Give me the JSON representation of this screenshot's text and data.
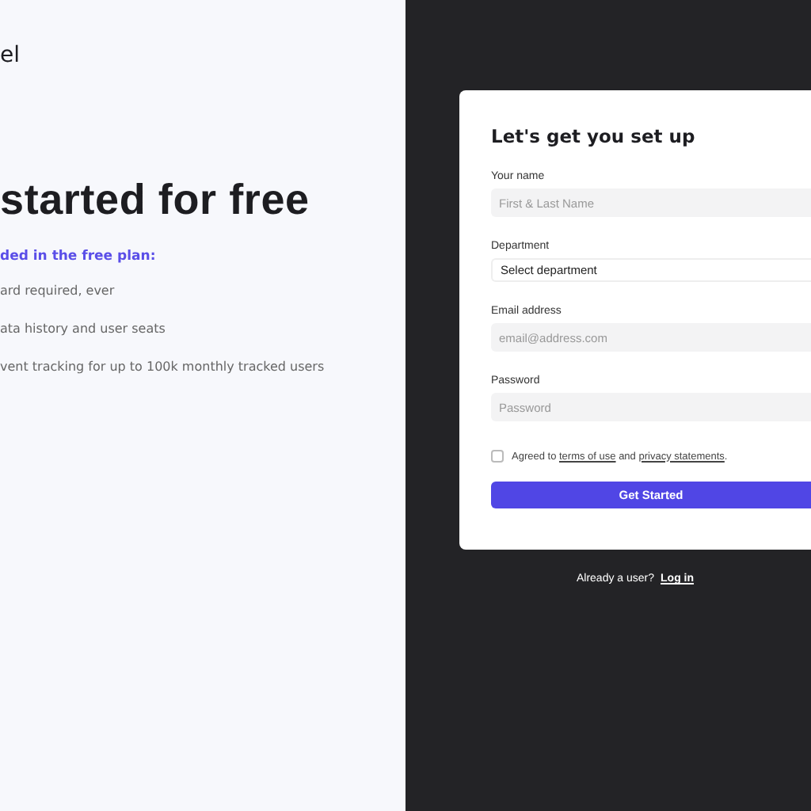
{
  "brand": {
    "text": "el"
  },
  "hero": {
    "title": "started for free",
    "subtitle": "ded in the free plan:",
    "bullets": [
      "ard required, ever",
      "ata history and user seats",
      "vent tracking for up to 100k monthly tracked users"
    ]
  },
  "form": {
    "title": "Let's get you set up",
    "fields": [
      {
        "kind": "text",
        "label": "Your name",
        "placeholder": "First & Last Name"
      },
      {
        "kind": "select",
        "label": "Department",
        "value": "Select department"
      },
      {
        "kind": "text",
        "label": "Email address",
        "placeholder": "email@address.com"
      },
      {
        "kind": "password",
        "label": "Password",
        "placeholder": "Password"
      }
    ],
    "consent": {
      "checked": false,
      "prefix": "Agreed to",
      "terms_link": "terms of use",
      "middle": "and",
      "privacy_link": "privacy statements",
      "suffix": "."
    },
    "submit": "Get Started"
  },
  "login_prompt": {
    "text": "Already a user?",
    "link": "Log in"
  }
}
